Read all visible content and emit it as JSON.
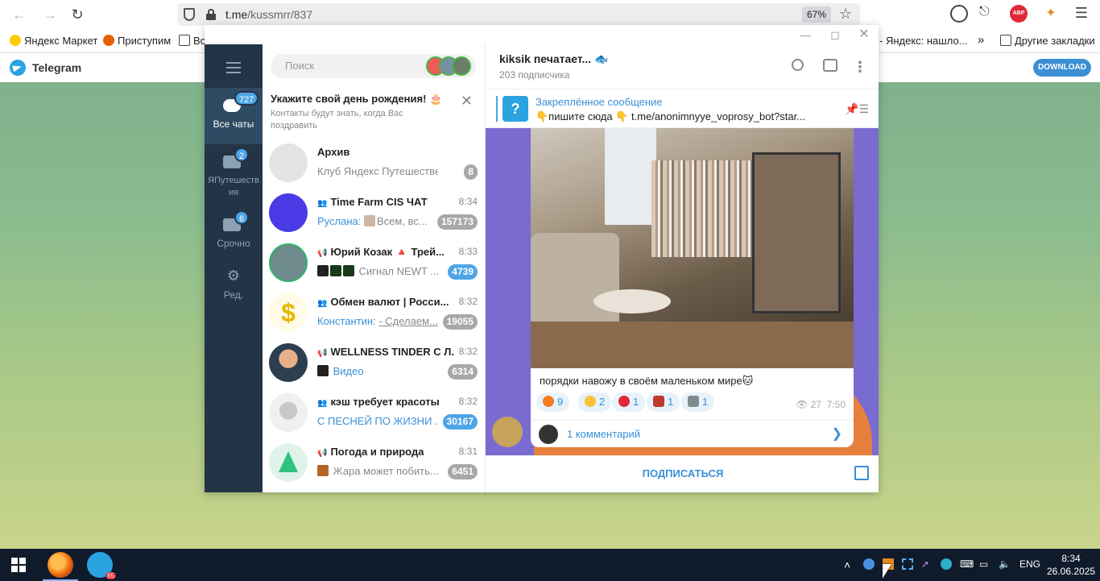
{
  "browser": {
    "url_host": "t.me",
    "url_path": "/kussmrr/837",
    "zoom": "67%",
    "abp_label": "ABP"
  },
  "bookmarks": [
    {
      "label": "Яндекс Маркет"
    },
    {
      "label": "Приступим"
    },
    {
      "label": "Вс"
    },
    {
      "label": "- Яндекс: нашло..."
    },
    {
      "label": "Другие закладки"
    }
  ],
  "tg_web": {
    "title": "Telegram",
    "download_label": "DOWNLOAD"
  },
  "folders": [
    {
      "label": "Все чаты",
      "badge": "727",
      "active": true
    },
    {
      "label": "ЯПутешествия",
      "badge": "2"
    },
    {
      "label": "Срочно",
      "badge": "6"
    },
    {
      "label": "Ред."
    }
  ],
  "search": {
    "placeholder": "Поиск"
  },
  "birthday": {
    "title": "Укажите свой день рождения! 🎂",
    "subtitle": "Контакты будут знать, когда Вас поздравить"
  },
  "chats": [
    {
      "name": "Архив",
      "time": "",
      "sender": "",
      "preview": "Клуб Яндекс Путешествен...",
      "unread": "8",
      "color": "#e0e0e0"
    },
    {
      "name": "Time Farm CIS ЧАТ",
      "time": "8:34",
      "sender": "Руслана:",
      "preview": "Всем, вс...",
      "unread": "157173",
      "color": "#4a3be6"
    },
    {
      "name": "Юрий Козак 🔺 Трей...",
      "time": "8:33",
      "sender": "",
      "preview": "Сигнал NEWT ...",
      "unread": "4739",
      "color": "#6f8a8c"
    },
    {
      "name": "Обмен валют | Росси...",
      "time": "8:32",
      "sender": "Константин:",
      "preview": "- Сделаем...",
      "unread": "19055",
      "color": "#f7e9a0"
    },
    {
      "name": "WELLNESS TINDER С Л...",
      "time": "8:32",
      "sender": "",
      "preview": "Видео",
      "unread": "6314",
      "color": "#2c3e50"
    },
    {
      "name": "кэш требует красоты",
      "time": "8:32",
      "sender": "",
      "preview": "С ПЕСНЕЙ ПО ЖИЗНИ ...",
      "unread": "30167",
      "color": "#dcdcdc"
    },
    {
      "name": "Погода и природа",
      "time": "8:31",
      "sender": "",
      "preview": "Жара может побить...",
      "unread": "6451",
      "color": "#dff3ea"
    }
  ],
  "conversation": {
    "title": "kiksik печатает... 🐟",
    "subscribers": "203 подписчика",
    "pinned_title": "Закреплённое сообщение",
    "pinned_text": "👇пишите сюда 👇 t.me/anonimnyye_voprosy_bot?star...",
    "pinned_thumb": "?",
    "message_text": "порядки навожу в своём маленьком мире🐱",
    "reactions": [
      {
        "emoji": "fire",
        "count": "9",
        "color": "#f47b20"
      },
      {
        "emoji": "heart-face",
        "count": "2",
        "color": "#f9c339"
      },
      {
        "emoji": "heart",
        "count": "1",
        "color": "#e0283a"
      },
      {
        "emoji": "sticker",
        "count": "1",
        "color": "#c0392b"
      },
      {
        "emoji": "sticker-2",
        "count": "1",
        "color": "#7f8c8d"
      }
    ],
    "views": "27",
    "time": "7:50",
    "comments": "1 комментарий",
    "subscribe": "ПОДПИСАТЬСЯ"
  },
  "taskbar": {
    "telegram_badge": "65",
    "lang": "ENG",
    "time": "8:34",
    "date": "26.06.2025"
  }
}
